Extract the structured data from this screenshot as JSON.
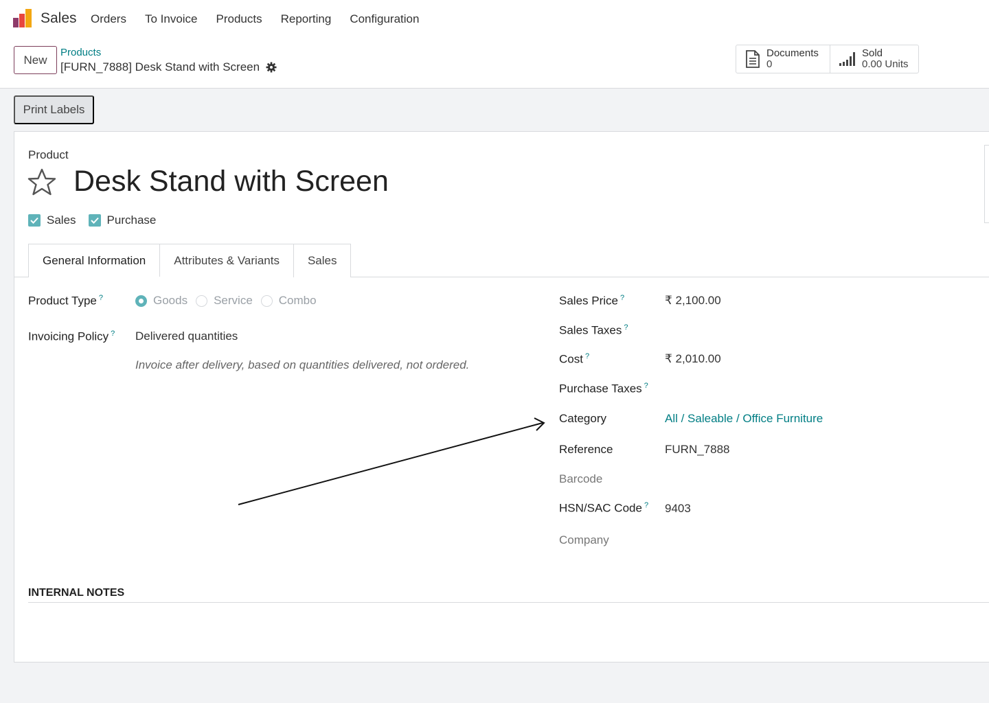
{
  "app": {
    "name": "Sales",
    "logo_icon": "odoo-sales-logo-icon"
  },
  "menu": [
    "Orders",
    "To Invoice",
    "Products",
    "Reporting",
    "Configuration"
  ],
  "control": {
    "new_label": "New",
    "breadcrumb": "Products",
    "record_title": "[FURN_7888] Desk Stand with Screen",
    "gear_icon": "gear-icon"
  },
  "smart_buttons": {
    "documents": {
      "label": "Documents",
      "value": "0",
      "icon": "document-icon"
    },
    "sold": {
      "label": "Sold",
      "value": "0.00 Units",
      "icon": "bar-chart-icon"
    }
  },
  "print_labels": "Print Labels",
  "form": {
    "product_label": "Product",
    "name": "Desk Stand with Screen",
    "favorite_icon": "star-icon",
    "checks": [
      {
        "label": "Sales",
        "checked": true
      },
      {
        "label": "Purchase",
        "checked": true
      }
    ],
    "tabs": [
      "General Information",
      "Attributes & Variants",
      "Sales"
    ],
    "active_tab": "General Information",
    "left": {
      "product_type_label": "Product Type",
      "product_type_options": [
        "Goods",
        "Service",
        "Combo"
      ],
      "product_type_selected": "Goods",
      "invoicing_policy_label": "Invoicing Policy",
      "invoicing_policy_value": "Delivered quantities",
      "invoicing_note": "Invoice after delivery, based on quantities delivered, not ordered."
    },
    "right": {
      "sales_price_label": "Sales Price",
      "sales_price_value": "₹ 2,100.00",
      "sales_taxes_label": "Sales Taxes",
      "cost_label": "Cost",
      "cost_value": "₹ 2,010.00",
      "purchase_taxes_label": "Purchase Taxes",
      "category_label": "Category",
      "category_value": "All / Saleable / Office Furniture",
      "reference_label": "Reference",
      "reference_value": "FURN_7888",
      "barcode_label": "Barcode",
      "hsn_label": "HSN/SAC Code",
      "hsn_value": "9403",
      "company_label": "Company"
    },
    "help_mark": "?",
    "internal_notes_label": "INTERNAL NOTES"
  },
  "colors": {
    "accent": "#017e84",
    "check": "#5fb3b9",
    "brand": "#714b67"
  }
}
